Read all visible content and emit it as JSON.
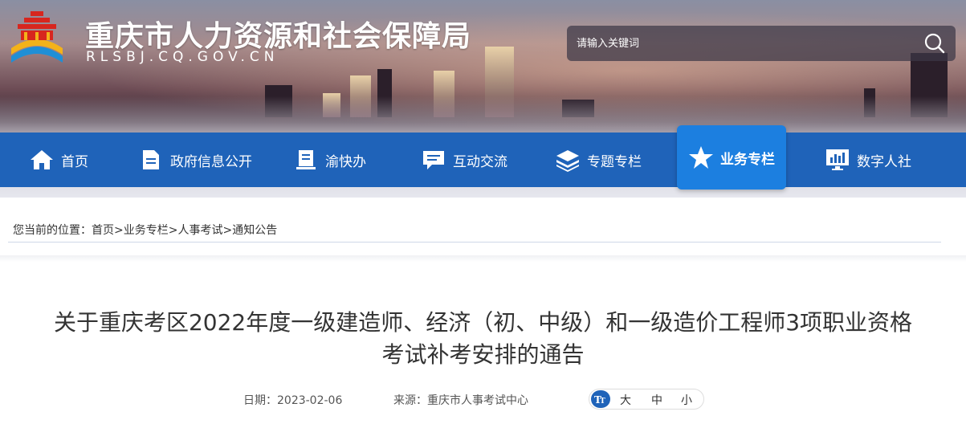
{
  "header": {
    "site_title": "重庆市人力资源和社会保障局",
    "site_url": "RLSBJ.CQ.GOV.CN",
    "logo_icon": "government-emblem-icon",
    "search": {
      "placeholder": "请输入关键词",
      "icon": "search-icon"
    }
  },
  "nav": {
    "items": [
      {
        "label": "首页",
        "icon": "home-icon"
      },
      {
        "label": "政府信息公开",
        "icon": "document-icon"
      },
      {
        "label": "渝快办",
        "icon": "book-icon"
      },
      {
        "label": "互动交流",
        "icon": "chat-icon"
      },
      {
        "label": "专题专栏",
        "icon": "layers-icon"
      },
      {
        "label": "业务专栏",
        "icon": "star-icon",
        "active": true
      },
      {
        "label": "数字人社",
        "icon": "monitor-icon"
      }
    ],
    "colors": {
      "bar": "#1f63b9",
      "active": "#1c7fe0"
    }
  },
  "breadcrumb": {
    "prefix": "您当前的位置：",
    "items": [
      "首页",
      "业务专栏",
      "人事考试",
      "通知公告"
    ],
    "separator": ">"
  },
  "article": {
    "title_line1": "关于重庆考区2022年度一级建造师、经济（初、中级）和一级造价工程师3项职业资格",
    "title_line2": "考试补考安排的通告",
    "date": "日期：2023-02-06",
    "source": "来源：重庆市人事考试中心",
    "font_sizes": {
      "icon": "font-size-icon",
      "large": "大",
      "medium": "中",
      "small": "小"
    }
  }
}
